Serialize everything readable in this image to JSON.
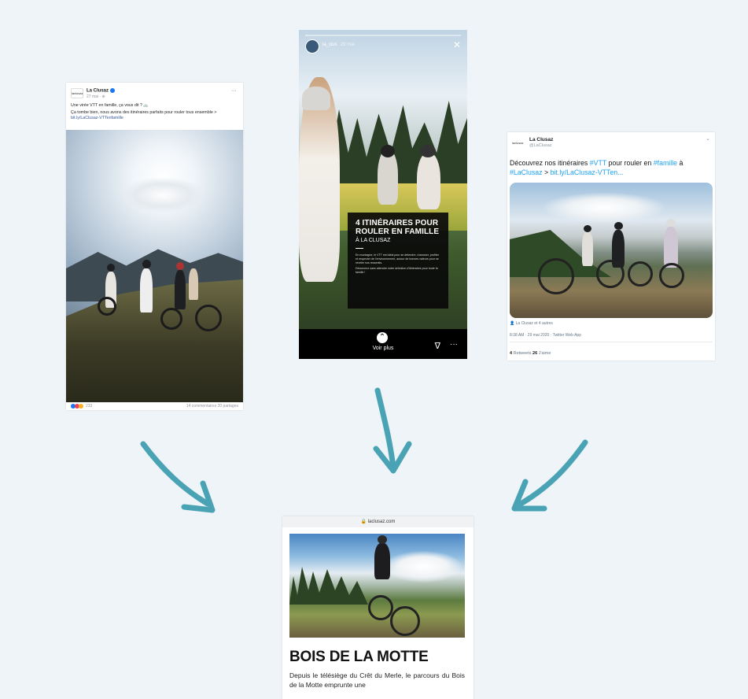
{
  "facebook": {
    "page_name": "La Clusaz",
    "logo_text": "laclusaz",
    "date": "27 mai · ⊕",
    "post_line1": "Une virée VTT en famille, ça vous dit ? 🚲",
    "post_line2": "Ça tombe bien, nous avons des itinéraires parfaits pour rouler tous ensemble > ",
    "post_link": "bit.ly/LaClusaz-VTTenfamille",
    "reactions_count": "233",
    "stats": "14 commentaires  20 partages",
    "more_icon": "···"
  },
  "instagram": {
    "username": "la_clus",
    "time": "29 mai",
    "close_icon": "✕",
    "title": "4 ITINÉRAIRES POUR ROULER EN FAMILLE",
    "subtitle": "À LA CLUSAZ",
    "body1": "En montagne, le VTT est idéal pour se détendre, s'amuser, profiter et respecter de l'environnement, autour de bonnes valeurs pour se révéler nos ressentis.",
    "body2": "Découvrez sans attendre notre sélection d'itinéraires pour toute la famille !",
    "swipe_icon": "⌃",
    "voir_plus": "Voir plus",
    "send_icon": "∇",
    "dots_icon": "···"
  },
  "twitter": {
    "name": "La Clusaz",
    "handle": "@LaClusaz",
    "logo_text": "laclusaz",
    "chevron": "⌄",
    "text_a": "Découvrez nos itinéraires ",
    "hashtag_vtt": "#VTT",
    "text_b": " pour rouler en ",
    "hashtag_famille": "#famille",
    "text_c": " à ",
    "hashtag_clusaz": "#LaClusaz",
    "text_d": " > ",
    "link": "bit.ly/LaClusaz-VTTen...",
    "tagged": "👤 La Clusaz et 4 autres",
    "timestamp": "8:38 AM · 29 mai 2020 · Twitter Web App",
    "retweets_count": "4",
    "retweets_label": " Retweets   ",
    "likes_count": "26",
    "likes_label": " J'aime"
  },
  "website": {
    "url": "🔒 laclusaz.com",
    "title": "BOIS DE LA MOTTE",
    "body": "Depuis le télésiège du Crêt du Merle, le parcours du Bois de la Motte emprunte une"
  },
  "colors": {
    "background": "#eef4f8",
    "arrow": "#4aa3b4",
    "facebook_blue": "#1877f2",
    "twitter_blue": "#1da1f2"
  }
}
